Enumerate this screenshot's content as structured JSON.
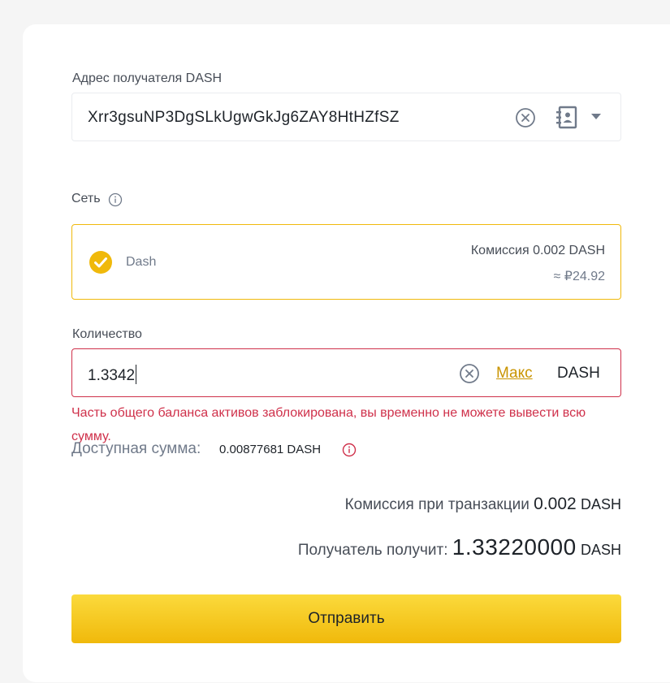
{
  "address": {
    "label": "Адрес получателя DASH",
    "value": "Xrr3gsuNP3DgSLkUgwGkJg6ZAY8HtHZfSZ"
  },
  "network": {
    "label": "Сеть",
    "name": "Dash",
    "fee": "Комиссия 0.002 DASH",
    "fee_fiat": "≈ ₽24.92"
  },
  "amount": {
    "label": "Количество",
    "value": "1.3342",
    "max_label": "Макс",
    "unit": "DASH",
    "error": "Часть общего баланса активов заблокирована, вы временно не можете вывести всю сумму.",
    "available_label": "Доступная сумма:",
    "available_value": "0.00877681 DASH"
  },
  "summary": {
    "fee_label": "Комиссия при транзакции",
    "fee_value": "0.002",
    "fee_unit": "DASH",
    "receive_label": "Получатель получит:",
    "receive_value": "1.33220000",
    "receive_unit": "DASH"
  },
  "submit_label": "Отправить",
  "colors": {
    "accent": "#f0b90b",
    "error": "#cf304a",
    "link": "#c99400"
  },
  "icons": [
    "clear-icon",
    "address-book-icon",
    "dropdown-caret-icon",
    "info-icon",
    "check-circle-icon"
  ]
}
